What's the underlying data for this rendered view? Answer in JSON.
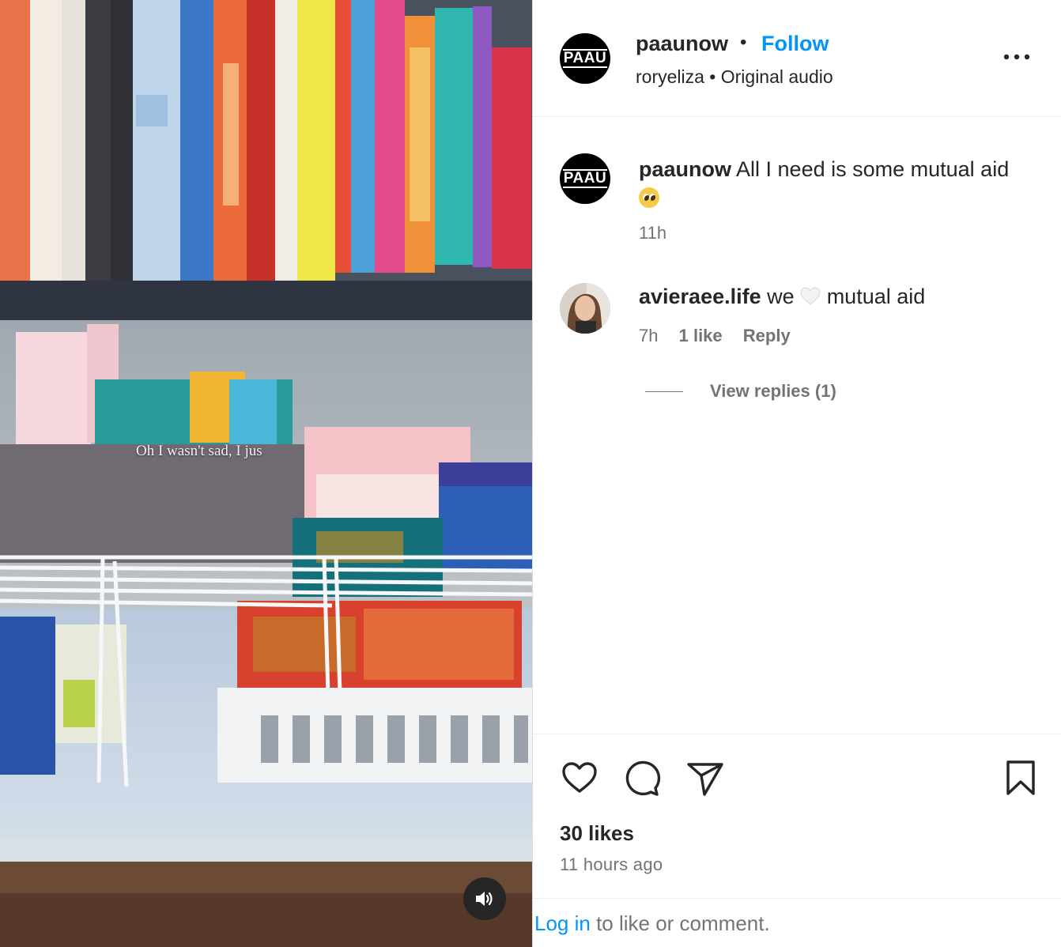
{
  "post": {
    "media": {
      "caption_overlay": "Oh I wasn't sad, I jus",
      "audio_icon": "speaker-icon"
    },
    "header": {
      "avatar_text": "PAAU",
      "username": "paaunow",
      "separator": "•",
      "follow_label": "Follow",
      "subline": "roryeliza • Original audio",
      "more_icon": "more-horizontal-icon"
    },
    "caption_comment": {
      "avatar_text": "PAAU",
      "username": "paaunow",
      "text": "All I need is some mutual aid",
      "emoji": "pleading-face",
      "time": "11h"
    },
    "reply_comment": {
      "username": "avieraee.life",
      "text_before": "we",
      "emoji": "white-heart",
      "text_after": "mutual aid",
      "time": "7h",
      "likes": "1 like",
      "reply_label": "Reply",
      "view_replies": "View replies (1)"
    },
    "actions": {
      "like_icon": "heart-icon",
      "comment_icon": "comment-icon",
      "share_icon": "send-icon",
      "save_icon": "bookmark-icon",
      "likes_count": "30 likes",
      "time_ago": "11 hours ago"
    },
    "login_prompt": {
      "link_text": "Log in",
      "rest_text": " to like or comment."
    }
  },
  "colors": {
    "link_blue": "#0095f6",
    "text_primary": "#262626",
    "text_secondary": "#737373",
    "divider": "#efefef"
  }
}
